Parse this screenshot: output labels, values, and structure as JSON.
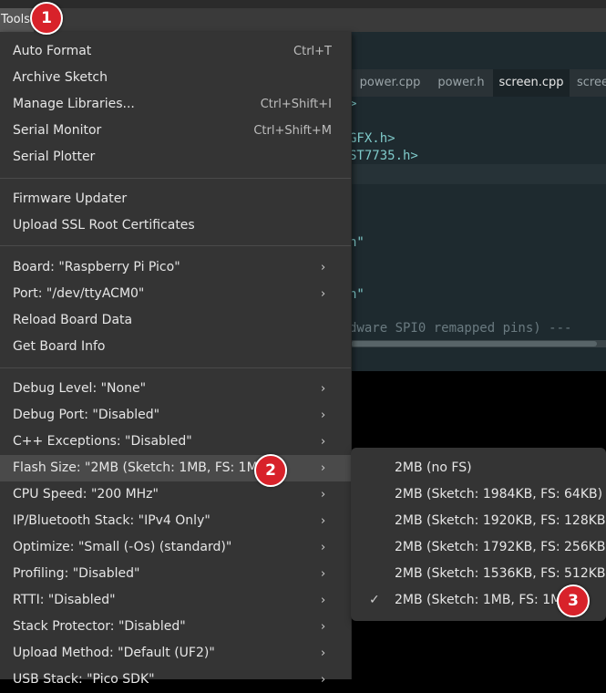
{
  "menubar": {
    "tools_label": "Tools"
  },
  "editor": {
    "tabs": [
      "power.cpp",
      "power.h",
      "screen.cpp",
      "scree"
    ],
    "code_lines": [
      ">",
      "GFX.h>",
      "ST7735.h>",
      "h\"",
      "h\"",
      "dware SPI0 remapped pins) ---"
    ]
  },
  "menu": {
    "groups": [
      [
        {
          "label": "Auto Format",
          "shortcut": "Ctrl+T"
        },
        {
          "label": "Archive Sketch"
        },
        {
          "label": "Manage Libraries...",
          "shortcut": "Ctrl+Shift+I"
        },
        {
          "label": "Serial Monitor",
          "shortcut": "Ctrl+Shift+M"
        },
        {
          "label": "Serial Plotter"
        }
      ],
      [
        {
          "label": "Firmware Updater"
        },
        {
          "label": "Upload SSL Root Certificates"
        }
      ],
      [
        {
          "label": "Board: \"Raspberry Pi Pico\"",
          "submenu": true
        },
        {
          "label": "Port: \"/dev/ttyACM0\"",
          "submenu": true
        },
        {
          "label": "Reload Board Data"
        },
        {
          "label": "Get Board Info"
        }
      ],
      [
        {
          "label": "Debug Level: \"None\"",
          "submenu": true
        },
        {
          "label": "Debug Port: \"Disabled\"",
          "submenu": true
        },
        {
          "label": "C++ Exceptions: \"Disabled\"",
          "submenu": true
        },
        {
          "label": "Flash Size: \"2MB (Sketch: 1MB, FS: 1MB)\"",
          "submenu": true,
          "highlighted": true
        },
        {
          "label": "CPU Speed: \"200 MHz\"",
          "submenu": true
        },
        {
          "label": "IP/Bluetooth Stack: \"IPv4 Only\"",
          "submenu": true
        },
        {
          "label": "Optimize: \"Small (-Os) (standard)\"",
          "submenu": true
        },
        {
          "label": "Profiling: \"Disabled\"",
          "submenu": true
        },
        {
          "label": "RTTI: \"Disabled\"",
          "submenu": true
        },
        {
          "label": "Stack Protector: \"Disabled\"",
          "submenu": true
        },
        {
          "label": "Upload Method: \"Default (UF2)\"",
          "submenu": true
        },
        {
          "label": "USB Stack: \"Pico SDK\"",
          "submenu": true
        }
      ]
    ],
    "submenu_arrow": "›"
  },
  "flash_submenu": {
    "items": [
      {
        "label": "2MB (no FS)"
      },
      {
        "label": "2MB (Sketch: 1984KB, FS: 64KB)"
      },
      {
        "label": "2MB (Sketch: 1920KB, FS: 128KB)"
      },
      {
        "label": "2MB (Sketch: 1792KB, FS: 256KB)"
      },
      {
        "label": "2MB (Sketch: 1536KB, FS: 512KB)"
      },
      {
        "label": "2MB (Sketch: 1MB, FS: 1MB)",
        "checked": true
      }
    ],
    "check_glyph": "✓"
  },
  "annotations": [
    "1",
    "2",
    "3"
  ],
  "colors": {
    "badge": "#d8222a",
    "menu_bg": "#343434",
    "highlight": "#4a4a4a"
  }
}
